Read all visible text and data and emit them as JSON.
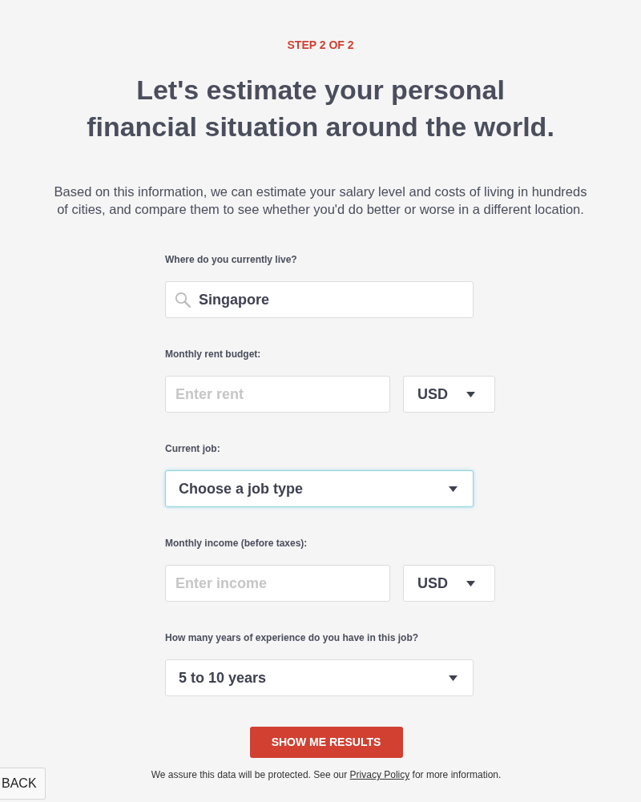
{
  "step_label": "STEP 2 OF 2",
  "heading_lines": [
    "Let's estimate your personal",
    "financial situation around the world."
  ],
  "intro": "Based on this information, we can estimate your salary level and costs of living in hundreds of cities, and compare them to see whether you'd do better or worse in a different location.",
  "fields": [
    {
      "kind": "search",
      "label": "Where do you currently live?",
      "value": "Singapore",
      "focused": false
    },
    {
      "kind": "amount",
      "label": "Monthly rent budget:",
      "placeholder": "Enter rent",
      "currency": "USD",
      "focused": false
    },
    {
      "kind": "select",
      "label": "Current job:",
      "value": "Choose a job type",
      "focused": true
    },
    {
      "kind": "amount",
      "label": "Monthly income (before taxes):",
      "placeholder": "Enter income",
      "currency": "USD",
      "focused": false
    },
    {
      "kind": "select",
      "label": "How many years of experience do you have in this job?",
      "value": "5 to 10 years",
      "focused": false
    }
  ],
  "submit_button": "SHOW ME RESULTS",
  "privacy_note": {
    "before": "We assure this data will be protected. See our ",
    "link": "Privacy Policy",
    "after": " for more information."
  },
  "back_button": "BACK"
}
